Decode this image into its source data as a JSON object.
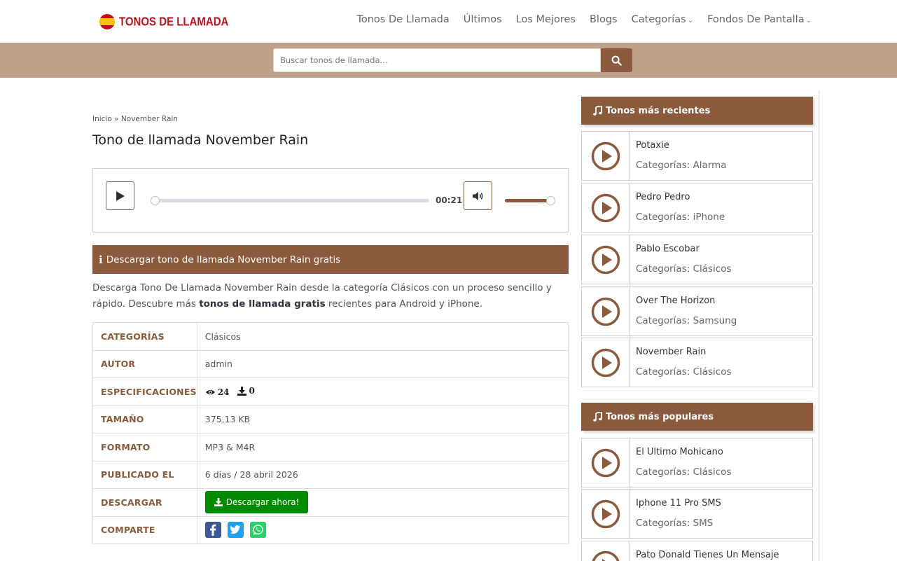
{
  "header": {
    "logo_text": "TONOS DE LLAMADA",
    "nav": [
      {
        "label": "Tonos De Llamada"
      },
      {
        "label": "Últimos"
      },
      {
        "label": "Los Mejores"
      },
      {
        "label": "Blogs"
      },
      {
        "label": "Categorías",
        "has_dropdown": true
      },
      {
        "label": "Fondos De Pantalla",
        "has_dropdown": true
      }
    ]
  },
  "search": {
    "placeholder": "Buscar tonos de llamada...",
    "button_icon": "search-icon"
  },
  "breadcrumb": {
    "home": "Inicio",
    "separator": "»",
    "current": "November Rain"
  },
  "page": {
    "title": "Tono de llamada November Rain"
  },
  "player": {
    "time": "00:21",
    "progress": 0.0,
    "volume": 1.0
  },
  "download_section": {
    "bar_label": "Descargar tono de llamada November Rain gratis",
    "desc_before": "Descarga Tono De Llamada November Rain desde la categoría Clásicos con un proceso sencillo y rápido. Descubre más ",
    "desc_link": "tonos de llamada gratis",
    "desc_after": " recientes para Android y iPhone."
  },
  "details": {
    "categorias_label": "CATEGORÍAS",
    "categorias_value": "Clásicos",
    "autor_label": "AUTOR",
    "autor_value": "admin",
    "especificaciones_label": "ESPECIFICACIONES",
    "views": "24",
    "downloads": "0",
    "tamano_label": "TAMAÑO",
    "tamano_value": "375,13 KB",
    "formato_label": "FORMATO",
    "formato_value": "MP3 & M4R",
    "publicado_label": "PUBLICADO EL",
    "publicado_value": "6 días / 28 abril 2026",
    "descargar_label": "DESCARGAR",
    "descargar_button": "Descargar ahora!",
    "comparte_label": "COMPARTE"
  },
  "sidebar": {
    "recent_title": "Tonos más recientes",
    "recent": [
      {
        "title": "Potaxie",
        "category": "Categorías: Alarma"
      },
      {
        "title": "Pedro Pedro",
        "category": "Categorías: iPhone"
      },
      {
        "title": "Pablo Escobar",
        "category": "Categorías: Clásicos"
      },
      {
        "title": "Over The Horizon",
        "category": "Categorías: Samsung"
      },
      {
        "title": "November Rain",
        "category": "Categorías: Clásicos"
      }
    ],
    "popular_title": "Tonos más populares",
    "popular": [
      {
        "title": "El Ultimo Mohicano",
        "category": "Categorías: Clásicos"
      },
      {
        "title": "Iphone 11 Pro SMS",
        "category": "Categorías: SMS"
      },
      {
        "title": "Pato Donald Tienes Un Mensaje",
        "category": ""
      }
    ]
  },
  "colors": {
    "brand_brown": "#8b5a3c",
    "search_band": "#bfa18a",
    "download_green": "#008a00",
    "logo_red": "#b8151d",
    "facebook": "#3b5998",
    "twitter": "#1da1f2",
    "whatsapp": "#25d366"
  }
}
